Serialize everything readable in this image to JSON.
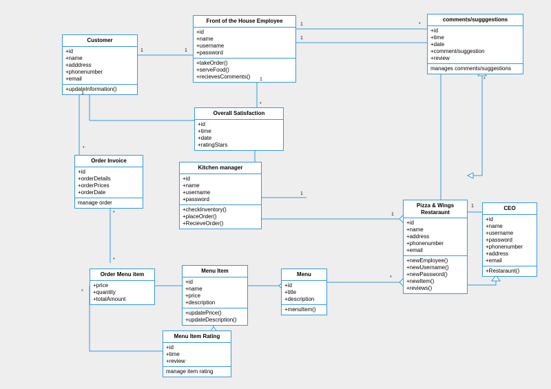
{
  "customer": {
    "title": "Customer",
    "attrs": [
      "+id",
      "+name",
      "+adddress",
      "+phonenumber",
      "+email"
    ],
    "ops": [
      "+updateInformation()"
    ]
  },
  "foh": {
    "title": "Front of the House Employee",
    "attrs": [
      "+id",
      "+name",
      "+username",
      "+password"
    ],
    "ops": [
      "+takeOrder()",
      "+serveFood()",
      "+recievesComments()"
    ]
  },
  "cs": {
    "title": "comments/sugggestions",
    "attrs": [
      "+id",
      "+time",
      "+date",
      "+comment/suggestion",
      "+review"
    ],
    "note": "manages comments/suggestions"
  },
  "sat": {
    "title": "Overall Satisfaction",
    "attrs": [
      "+id",
      "+time",
      "+date",
      "+ratingStars"
    ]
  },
  "invoice": {
    "title": "Order Invoice",
    "attrs": [
      "+id",
      "+orderDetails",
      "+orderPrices",
      "+orderDate"
    ],
    "note": "manage order"
  },
  "km": {
    "title": "Kitchen manager",
    "attrs": [
      "+id",
      "+name",
      "+username",
      "+password"
    ],
    "ops": [
      "+checkInventory()",
      "+placeOrder()",
      "+RecieveOrder()"
    ]
  },
  "rest": {
    "title": "Pizza & Wings Restaraunt",
    "attrs": [
      "+id",
      "+name",
      "+address",
      "+phonenumber",
      "+email"
    ],
    "ops": [
      "+newEmployee()",
      "+newUsername()",
      "+newPassword()",
      "+newItem()",
      "+reviews()"
    ]
  },
  "ceo": {
    "title": "CEO",
    "attrs": [
      "+id",
      "+name",
      "+username",
      "+password",
      "+phonenumber",
      "+address",
      "+email"
    ],
    "ops": [
      "+Restaraunt()"
    ]
  },
  "omi": {
    "title": "Order Menu item",
    "attrs": [
      "+price",
      "+quantity",
      "+totalAmount"
    ]
  },
  "mi": {
    "title": "Menu Item",
    "attrs": [
      "+id",
      "+name",
      "+price",
      "+description"
    ],
    "ops": [
      "+updatePrice()",
      "+updateDescription()"
    ]
  },
  "menu": {
    "title": "Menu",
    "attrs": [
      "+id",
      "+title",
      "+description"
    ],
    "ops": [
      "+menuItem()"
    ]
  },
  "mir": {
    "title": "Menu Item Rating",
    "attrs": [
      "+id",
      "+time",
      "+review"
    ],
    "note": "manage item rating"
  },
  "card": {
    "one": "1",
    "star": "*"
  }
}
